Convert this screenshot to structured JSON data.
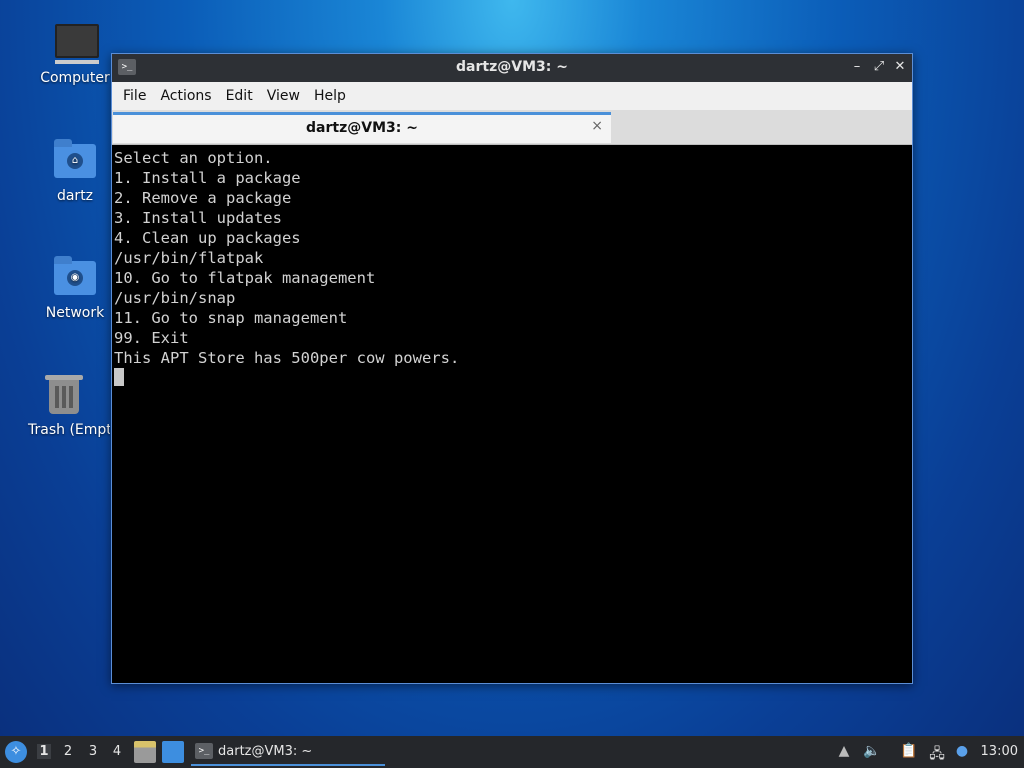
{
  "desktop": {
    "icons": [
      {
        "label": "Computer"
      },
      {
        "label": "dartz"
      },
      {
        "label": "Network"
      },
      {
        "label": "Trash (Empty)"
      }
    ]
  },
  "window": {
    "title": "dartz@VM3: ~",
    "menu": [
      "File",
      "Actions",
      "Edit",
      "View",
      "Help"
    ],
    "tab": {
      "label": "dartz@VM3: ~",
      "close": "×"
    },
    "buttons": {
      "minimize": "–",
      "maximize": "⤢",
      "close": "✕"
    },
    "terminal_lines": [
      "Select an option.",
      "1. Install a package",
      "2. Remove a package",
      "3. Install updates",
      "4. Clean up packages",
      "/usr/bin/flatpak",
      "10. Go to flatpak management",
      "/usr/bin/snap",
      "11. Go to snap management",
      "99. Exit",
      "This APT Store has 500per cow powers."
    ]
  },
  "taskbar": {
    "workspaces": [
      "1",
      "2",
      "3",
      "4"
    ],
    "active_workspace": "1",
    "task_label": "dartz@VM3: ~",
    "clock": "13:00"
  },
  "colors": {
    "accent": "#4a90d9",
    "titlebar": "#2d3035",
    "terminal_bg": "#000000",
    "terminal_fg": "#d2d2d2"
  }
}
